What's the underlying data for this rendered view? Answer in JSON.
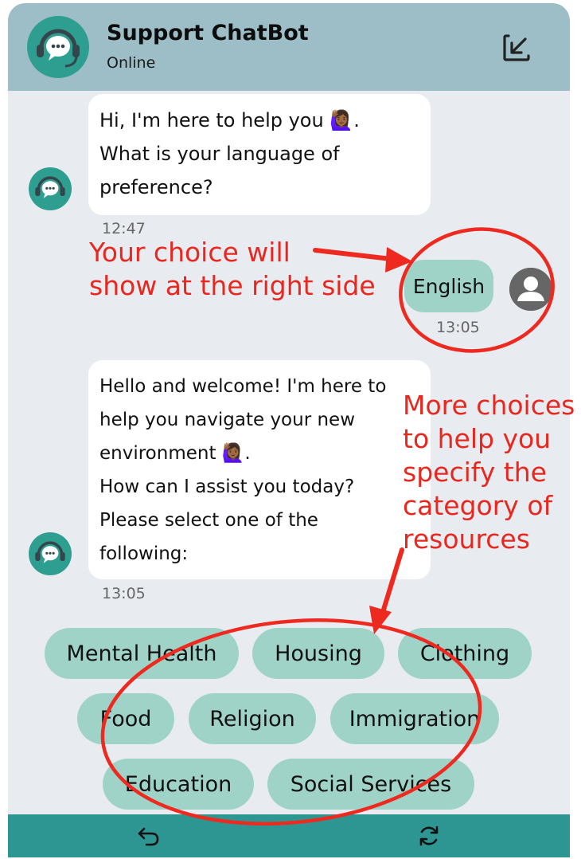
{
  "header": {
    "title": "Support ChatBot",
    "status": "Online",
    "bot_icon": "headset-chat-icon",
    "minimize_icon": "minimize-arrow-icon"
  },
  "messages": [
    {
      "sender": "bot",
      "lines": [
        "Hi, I'm here to help you 🙋🏾‍♀️.",
        "What is your language of",
        "preference?"
      ],
      "time": "12:47"
    },
    {
      "sender": "user",
      "text": "English",
      "time": "13:05"
    },
    {
      "sender": "bot",
      "lines": [
        "Hello and welcome! I'm here to",
        "help you navigate your new",
        "environment 🙋🏾‍♀️.",
        "How can I assist you today?",
        "Please select one of the",
        "following:"
      ],
      "time": "13:05"
    }
  ],
  "choices": [
    "Mental Health",
    "Housing",
    "Clothing",
    "Food",
    "Religion",
    "Immigration",
    "Education",
    "Social Services"
  ],
  "footer": {
    "back_icon": "undo-arrow-icon",
    "refresh_icon": "refresh-icon"
  },
  "annotations": {
    "right_side": [
      "Your choice will",
      "show at the right side"
    ],
    "more_choices": [
      "More choices",
      "to help you",
      "specify the",
      "category of",
      "resources"
    ]
  },
  "colors": {
    "header_bg": "#9dbec7",
    "chat_bg": "#e8ebef",
    "accent": "#2e9e90",
    "choice_bg": "#9fd3c7",
    "footer_bg": "#2e9692",
    "annotation_red": "#e8271f"
  }
}
